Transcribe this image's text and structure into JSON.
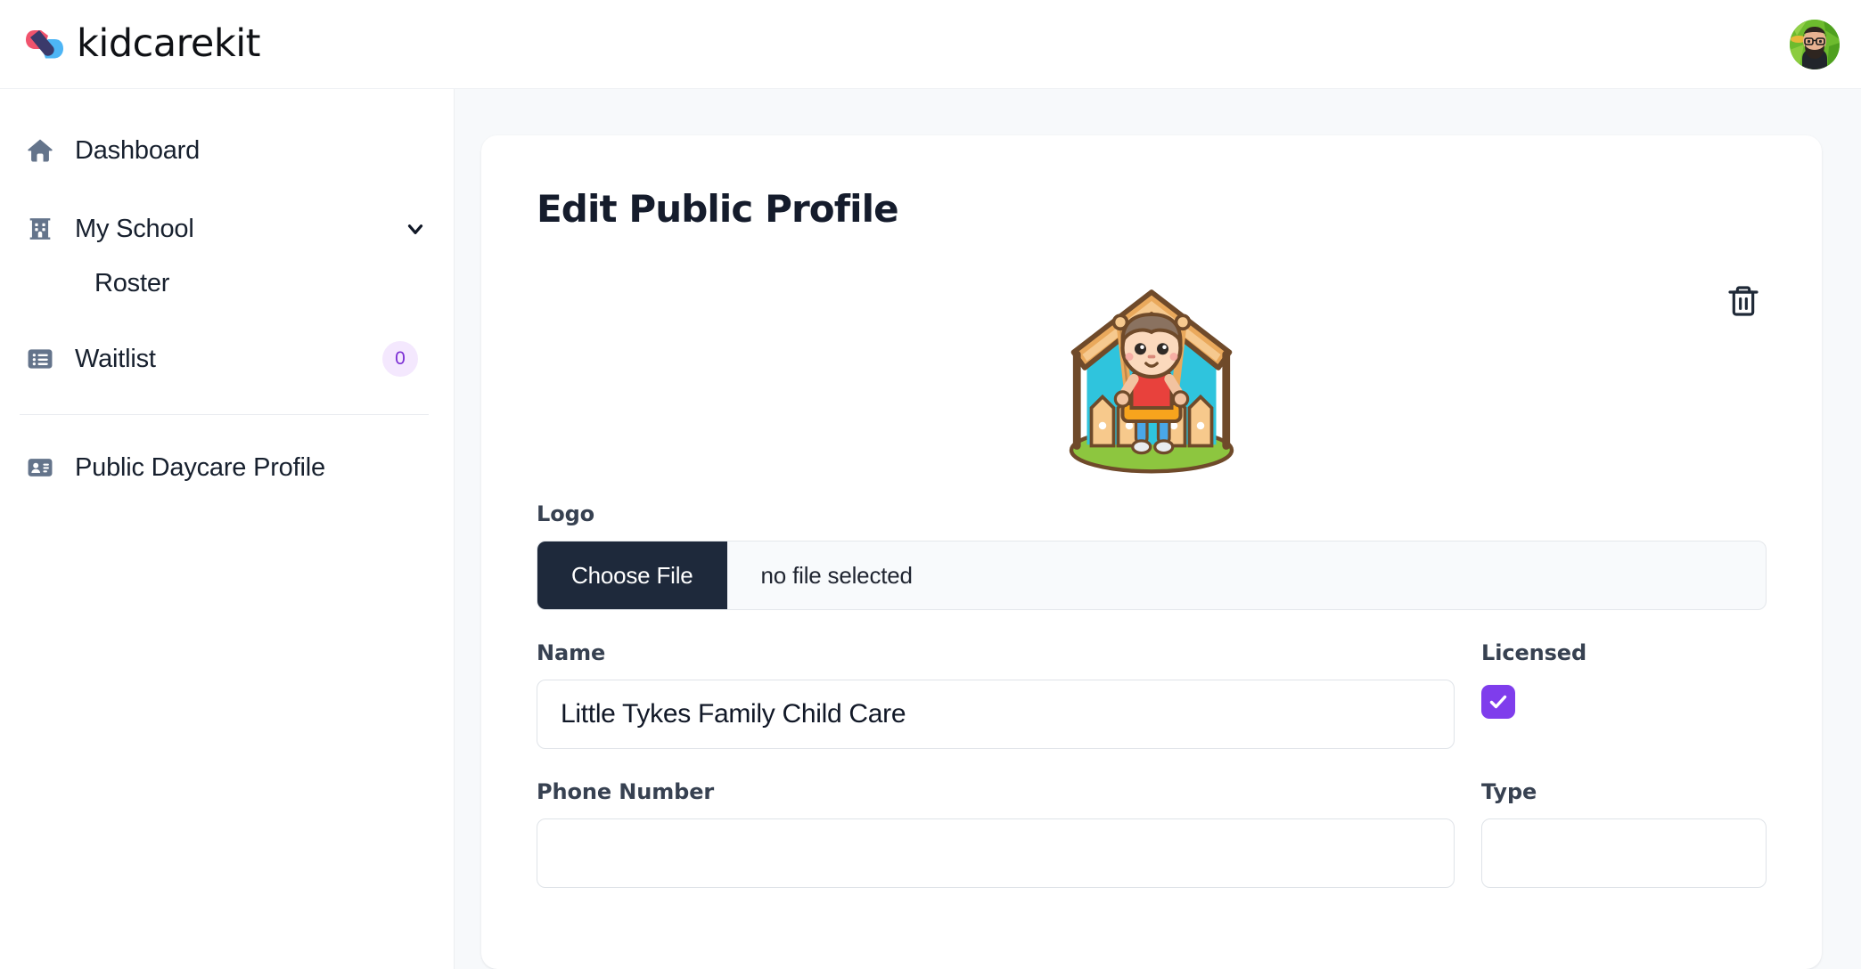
{
  "brand": {
    "name": "kidcarekit",
    "logo_colors": {
      "pink": "#f0536d",
      "navy": "#3b3a6b",
      "blue": "#4db5f5"
    }
  },
  "topbar": {
    "avatar_alt": "user-avatar"
  },
  "sidebar": {
    "items": [
      {
        "label": "Dashboard",
        "icon": "home-icon"
      },
      {
        "label": "My School",
        "icon": "building-icon",
        "expanded": true,
        "chevron": "chevron-down-icon"
      },
      {
        "label": "Roster",
        "icon": "none",
        "child": true
      },
      {
        "label": "Waitlist",
        "icon": "list-icon",
        "badge": "0"
      },
      {
        "label": "Public Daycare Profile",
        "icon": "id-card-icon"
      }
    ],
    "badge_bg": "#f4e8fe",
    "badge_color": "#7c2fd4"
  },
  "main": {
    "title": "Edit Public Profile",
    "delete_icon": "trash-icon",
    "logo_preview_alt": "daycare-logo-child-on-swing-in-house",
    "fields": {
      "logo": {
        "label": "Logo",
        "choose_button": "Choose File",
        "file_status": "no file selected"
      },
      "name": {
        "label": "Name",
        "value": "Little Tykes Family Child Care",
        "placeholder": ""
      },
      "licensed": {
        "label": "Licensed",
        "checked": true,
        "accent": "#7f3dec"
      },
      "phone": {
        "label": "Phone Number",
        "value": "",
        "placeholder": ""
      },
      "type": {
        "label": "Type",
        "value": ""
      }
    }
  }
}
